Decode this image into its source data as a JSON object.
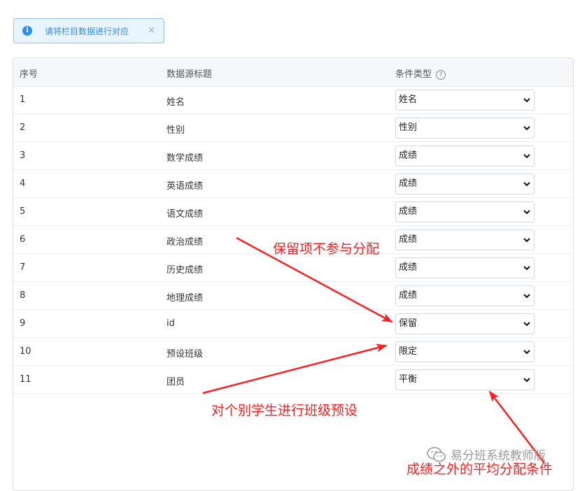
{
  "alert": {
    "text": "请将栏目数据进行对应",
    "close": "×"
  },
  "table": {
    "headers": {
      "index": "序号",
      "title": "数据源标题",
      "type": "条件类型",
      "help": "?"
    },
    "rows": [
      {
        "index": "1",
        "title": "姓名",
        "type": "姓名"
      },
      {
        "index": "2",
        "title": "性别",
        "type": "性别"
      },
      {
        "index": "3",
        "title": "数学成绩",
        "type": "成绩"
      },
      {
        "index": "4",
        "title": "英语成绩",
        "type": "成绩"
      },
      {
        "index": "5",
        "title": "语文成绩",
        "type": "成绩"
      },
      {
        "index": "6",
        "title": "政治成绩",
        "type": "成绩"
      },
      {
        "index": "7",
        "title": "历史成绩",
        "type": "成绩"
      },
      {
        "index": "8",
        "title": "地理成绩",
        "type": "成绩"
      },
      {
        "index": "9",
        "title": "id",
        "type": "保留"
      },
      {
        "index": "10",
        "title": "预设班级",
        "type": "限定"
      },
      {
        "index": "11",
        "title": "团员",
        "type": "平衡"
      }
    ]
  },
  "annotations": {
    "reserve": "保留项不参与分配",
    "preset": "对个别学生进行班级预设",
    "balance": "成绩之外的平均分配条件",
    "color": "#ff1f1f"
  },
  "watermark": {
    "text": "易分班系统教师版",
    "icon": "wechat-icon"
  }
}
